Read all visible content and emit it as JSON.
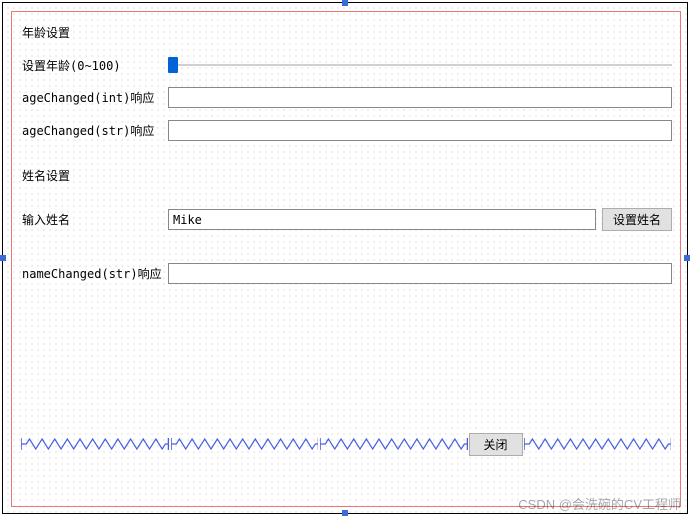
{
  "age_group": {
    "title": "年龄设置",
    "slider_label": "设置年龄(0~100)",
    "slider_value": 0,
    "int_resp_label": "ageChanged(int)响应",
    "int_resp_value": "",
    "str_resp_label": "ageChanged(str)响应",
    "str_resp_value": ""
  },
  "name_group": {
    "title": "姓名设置",
    "input_label": "输入姓名",
    "input_value": "Mike",
    "set_btn": "设置姓名",
    "str_resp_label": "nameChanged(str)响应",
    "str_resp_value": ""
  },
  "close_btn": "关闭",
  "watermark": "CSDN @会洗碗的CV工程师",
  "colors": {
    "selection_handle": "#3b6bd6",
    "layout_border": "#e87878",
    "slider_thumb": "#0063d6",
    "spring": "#4a5fe0"
  }
}
